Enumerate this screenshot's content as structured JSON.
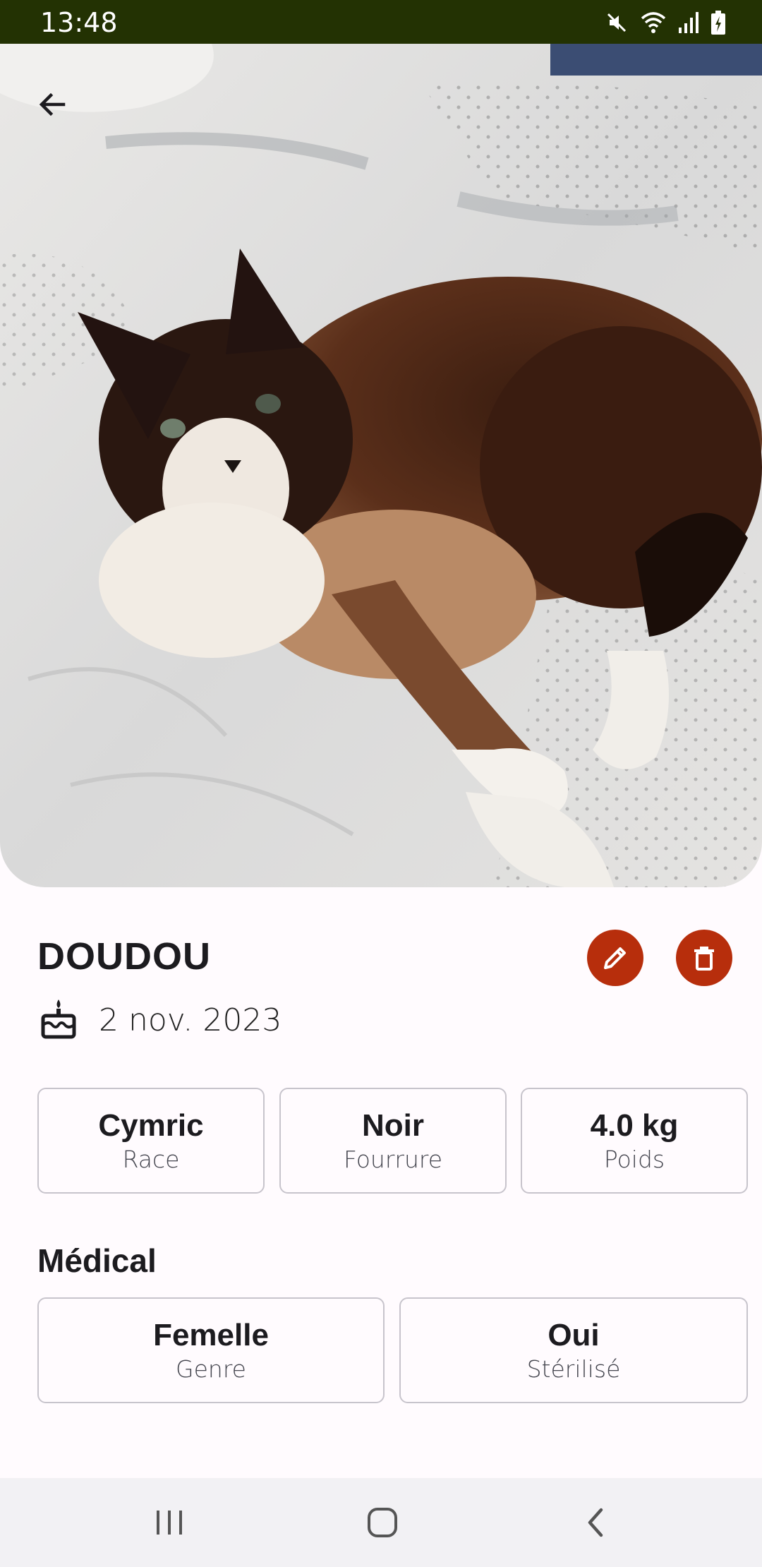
{
  "status_bar": {
    "time": "13:48",
    "icons": [
      "mute-icon",
      "wifi-icon",
      "signal-icon",
      "battery-charging-icon"
    ]
  },
  "pet": {
    "name": "DOUDOU",
    "birth_date": "2 nov. 2023"
  },
  "actions": {
    "edit_icon": "pencil-icon",
    "delete_icon": "trash-icon",
    "accent_color": "#b72e0c"
  },
  "details": [
    {
      "value": "Cymric",
      "label": "Race"
    },
    {
      "value": "Noir",
      "label": "Fourrure"
    },
    {
      "value": "4.0 kg",
      "label": "Poids"
    }
  ],
  "medical": {
    "title": "Médical",
    "items": [
      {
        "value": "Femelle",
        "label": "Genre"
      },
      {
        "value": "Oui",
        "label": "Stérilisé"
      }
    ]
  },
  "colors": {
    "status_bar": "#233203",
    "background": "#fffbfe",
    "card_border": "#c7c4cc",
    "nav_bar": "#f2f1f4"
  }
}
